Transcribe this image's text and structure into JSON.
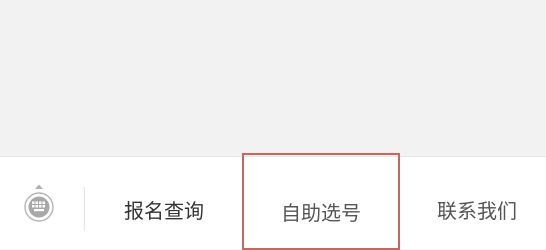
{
  "menu": {
    "items": [
      {
        "label": "报名查询"
      },
      {
        "label": "自助选号",
        "highlighted": true
      },
      {
        "label": "联系我们"
      }
    ],
    "keyboard_icon": "keyboard-toggle-icon"
  },
  "colors": {
    "content_background": "#f2f2f2",
    "menu_background": "#ffffff",
    "highlight_border": "#c9655f",
    "label_text": "#333333",
    "icon_gray": "#a8a8a8"
  }
}
